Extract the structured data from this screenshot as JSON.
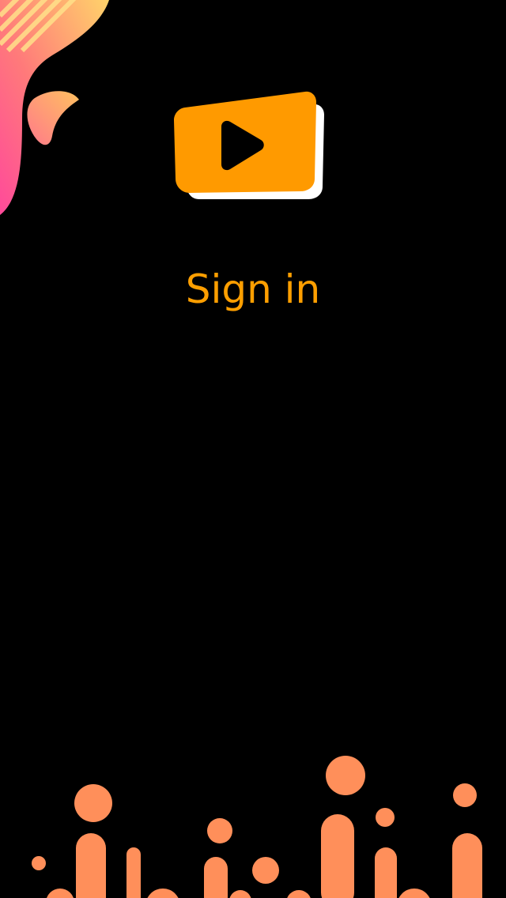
{
  "screen": {
    "title": "Sign in"
  },
  "logo": {
    "icon": "play-button-icon"
  },
  "colors": {
    "background": "#000000",
    "accent": "#ff9f00",
    "logo_fill": "#ff9a00",
    "logo_shadow": "#ffffff",
    "play_glyph": "#000000",
    "deco_gradient_start": "#ffd36a",
    "deco_gradient_end": "#ff4a9a",
    "dots_top": "#ff9a1f",
    "dots_bottom": "#ff8f5a"
  }
}
